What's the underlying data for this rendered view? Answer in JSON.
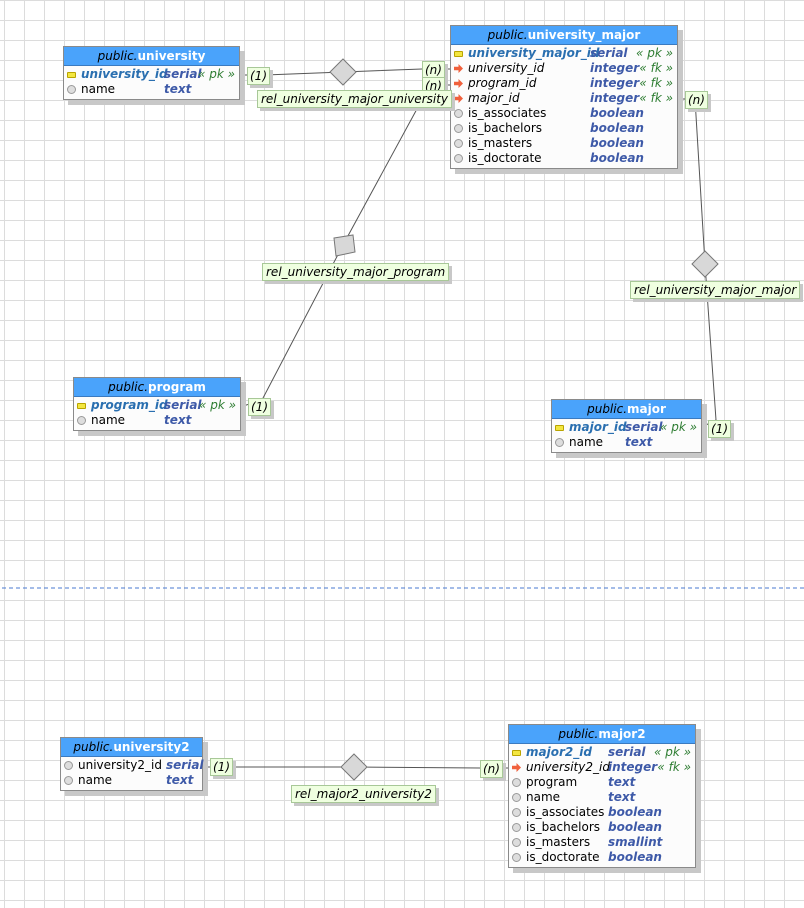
{
  "tables": [
    {
      "id": "university",
      "schema": "public.",
      "name": "university",
      "cols": [
        {
          "kind": "pk",
          "name": "university_id",
          "type": "serial",
          "con": "« pk »"
        },
        {
          "kind": "col",
          "name": "name",
          "type": "text",
          "con": ""
        }
      ]
    },
    {
      "id": "university_major",
      "schema": "public.",
      "name": "university_major",
      "cols": [
        {
          "kind": "pk",
          "name": "university_major_id",
          "type": "serial",
          "con": "« pk »"
        },
        {
          "kind": "fk",
          "name": "university_id",
          "type": "integer",
          "con": "« fk »"
        },
        {
          "kind": "fk",
          "name": "program_id",
          "type": "integer",
          "con": "« fk »"
        },
        {
          "kind": "fk",
          "name": "major_id",
          "type": "integer",
          "con": "« fk »"
        },
        {
          "kind": "col",
          "name": "is_associates",
          "type": "boolean",
          "con": ""
        },
        {
          "kind": "col",
          "name": "is_bachelors",
          "type": "boolean",
          "con": ""
        },
        {
          "kind": "col",
          "name": "is_masters",
          "type": "boolean",
          "con": ""
        },
        {
          "kind": "col",
          "name": "is_doctorate",
          "type": "boolean",
          "con": ""
        }
      ]
    },
    {
      "id": "program",
      "schema": "public.",
      "name": "program",
      "cols": [
        {
          "kind": "pk",
          "name": "program_id",
          "type": "serial",
          "con": "« pk »"
        },
        {
          "kind": "col",
          "name": "name",
          "type": "text",
          "con": ""
        }
      ]
    },
    {
      "id": "major",
      "schema": "public.",
      "name": "major",
      "cols": [
        {
          "kind": "pk",
          "name": "major_id",
          "type": "serial",
          "con": "« pk »"
        },
        {
          "kind": "col",
          "name": "name",
          "type": "text",
          "con": ""
        }
      ]
    },
    {
      "id": "university2",
      "schema": "public.",
      "name": "university2",
      "cols": [
        {
          "kind": "col",
          "name": "university2_id",
          "type": "serial",
          "con": ""
        },
        {
          "kind": "col",
          "name": "name",
          "type": "text",
          "con": ""
        }
      ]
    },
    {
      "id": "major2",
      "schema": "public.",
      "name": "major2",
      "cols": [
        {
          "kind": "pk",
          "name": "major2_id",
          "type": "serial",
          "con": "« pk »"
        },
        {
          "kind": "fk",
          "name": "university2_id",
          "type": "integer",
          "con": "« fk »"
        },
        {
          "kind": "col",
          "name": "program",
          "type": "text",
          "con": ""
        },
        {
          "kind": "col",
          "name": "name",
          "type": "text",
          "con": ""
        },
        {
          "kind": "col",
          "name": "is_associates",
          "type": "boolean",
          "con": ""
        },
        {
          "kind": "col",
          "name": "is_bachelors",
          "type": "boolean",
          "con": ""
        },
        {
          "kind": "col",
          "name": "is_masters",
          "type": "smallint",
          "con": ""
        },
        {
          "kind": "col",
          "name": "is_doctorate",
          "type": "boolean",
          "con": ""
        }
      ]
    }
  ],
  "relationships": [
    {
      "name": "rel_university_major_university",
      "from": "(1)",
      "to": "(n)"
    },
    {
      "name": "rel_university_major_program",
      "from": "(1)",
      "to": "(n)"
    },
    {
      "name": "rel_university_major_major",
      "from": "(1)",
      "to": "(n)"
    },
    {
      "name": "rel_major2_university2",
      "from": "(1)",
      "to": "(n)"
    }
  ],
  "colors": {
    "header": "#4aa3fb",
    "label_bg": "#efffe0",
    "separator": "#4a7ad0"
  }
}
